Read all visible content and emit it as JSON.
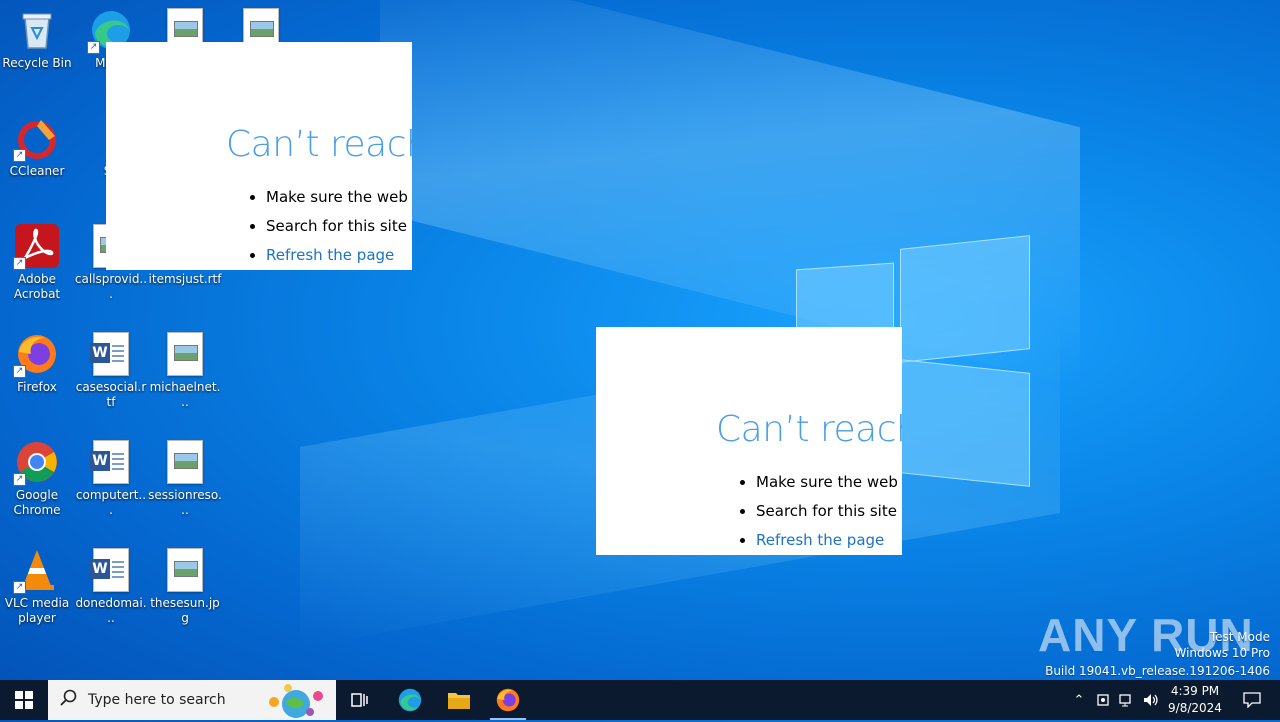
{
  "desktop": {
    "icons": [
      {
        "label": "Recycle Bin"
      },
      {
        "label": "Microsoft Edge",
        "visible": "Mic E"
      },
      {
        "label": "CCleaner"
      },
      {
        "label": "Sk"
      },
      {
        "label": "Adobe Acrobat"
      },
      {
        "label": "callsprovid..."
      },
      {
        "label": "itemsjust.rtf"
      },
      {
        "label": "Firefox"
      },
      {
        "label": "casesocial.rtf"
      },
      {
        "label": "michaelnet..."
      },
      {
        "label": "Google Chrome"
      },
      {
        "label": "computert..."
      },
      {
        "label": "sessionreso..."
      },
      {
        "label": "VLC media player"
      },
      {
        "label": "donedomai..."
      },
      {
        "label": "thesesun.jpg"
      }
    ]
  },
  "error_windows": [
    {
      "title": "Can’t reach t",
      "items": [
        "Make sure the web ad",
        "Search for this site on",
        "Refresh the page"
      ]
    },
    {
      "title": "Can’t reach t",
      "items": [
        "Make sure the web ad",
        "Search for this site on",
        "Refresh the page"
      ]
    }
  ],
  "watermark": {
    "brand": "ANY RUN",
    "line1": "Test Mode",
    "line2": "Windows 10 Pro",
    "line3": "Build 19041.vb_release.191206-1406"
  },
  "taskbar": {
    "search_placeholder": "Type here to search",
    "time": "4:39 PM",
    "date": "9/8/2024"
  },
  "colors": {
    "desktop_blue": "#0a86e8",
    "taskbar": "#0b1a2e",
    "error_title": "#4a9ee6",
    "link": "#1a73c9"
  }
}
